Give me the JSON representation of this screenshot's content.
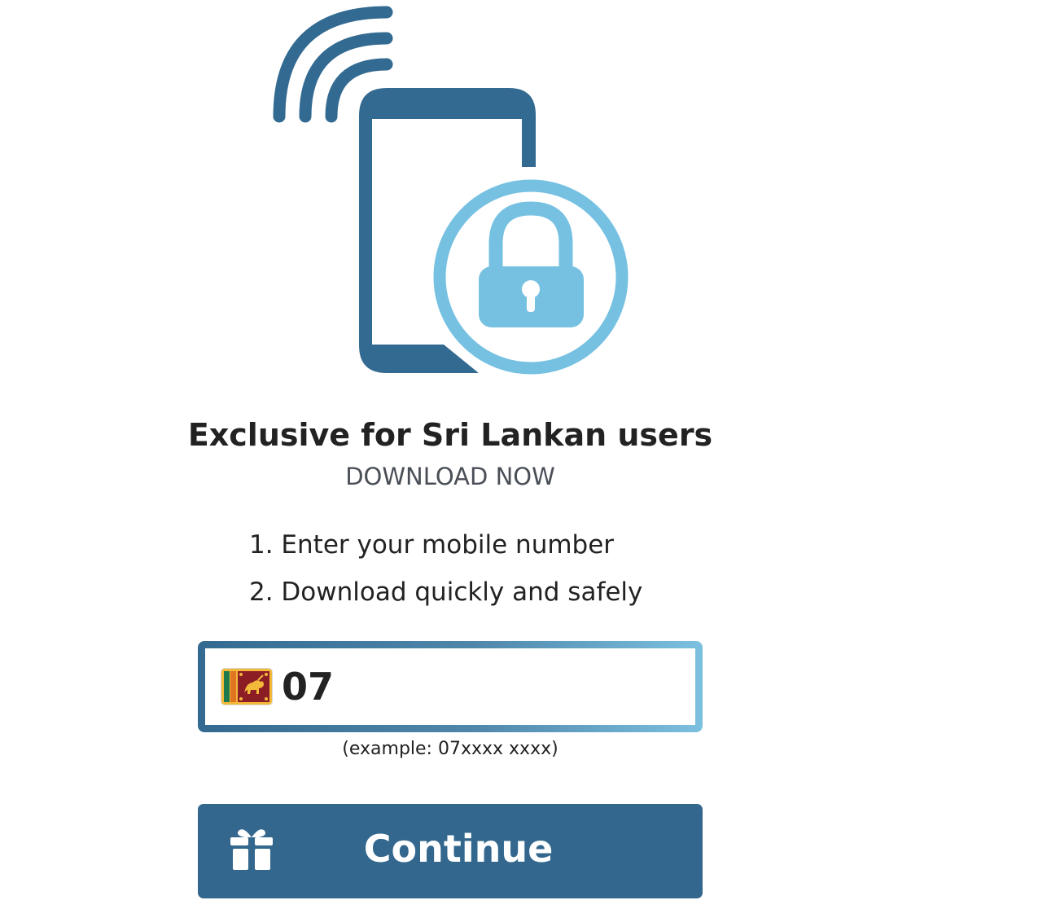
{
  "hero": {
    "illustration_icon": "phone-lock-icon",
    "signal_icon": "wifi-signal-icon",
    "lock_icon": "padlock-icon",
    "colors": {
      "phone": "#336a91",
      "lock": "#76c1e2"
    }
  },
  "heading": {
    "title": "Exclusive for Sri Lankan users",
    "subtitle": "DOWNLOAD NOW"
  },
  "steps": [
    {
      "text": "1. Enter your mobile number"
    },
    {
      "text": "2. Download quickly and safely"
    }
  ],
  "phone_form": {
    "flag_icon": "sri-lanka-flag-icon",
    "prefix": "07",
    "value": "",
    "example": "(example: 07xxxx xxxx)"
  },
  "continue_button": {
    "label": "Continue",
    "icon": "gift-icon",
    "color": "#33678d"
  }
}
